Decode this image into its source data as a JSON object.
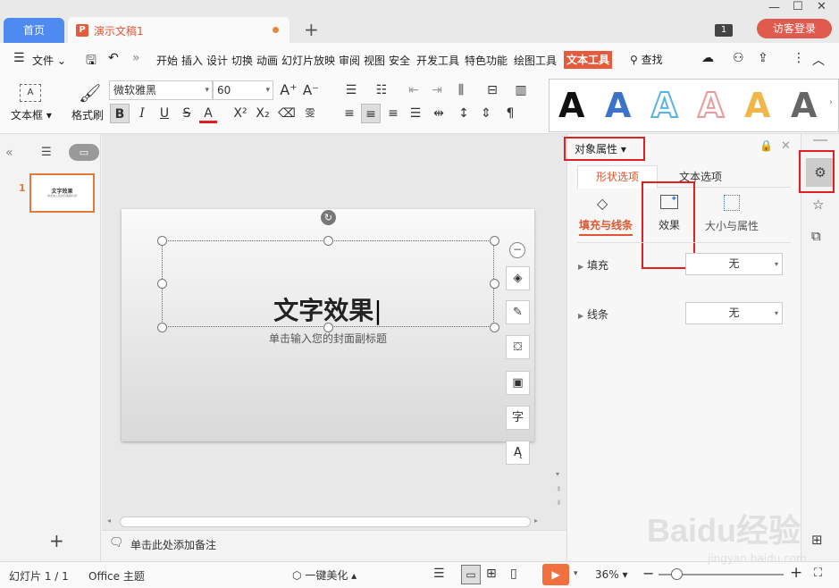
{
  "titlebar": {
    "home_tab": "首页",
    "doc_tab": "演示文稿1",
    "doc_icon": "P",
    "new_tab": "+",
    "badge": "1",
    "login_button": "访客登录"
  },
  "menu": {
    "file": "文件",
    "tabs": [
      "开始",
      "插入",
      "设计",
      "切换",
      "动画",
      "幻灯片放映",
      "审阅",
      "视图",
      "安全",
      "开发工具",
      "特色功能",
      "绘图工具"
    ],
    "active_tab": "文本工具",
    "search": "查找"
  },
  "ribbon": {
    "textbox": "文本框",
    "format_painter": "格式刷",
    "font_name": "微软雅黑",
    "font_size": "60",
    "style_letters": [
      "A",
      "A",
      "A",
      "A",
      "A",
      "A"
    ],
    "style_colors": [
      "#111111",
      "#3c73c8",
      "#58b4e0",
      "#e99a9a",
      "#f0b64a",
      "#666666"
    ]
  },
  "slide": {
    "number": "1",
    "thumb_title": "文字效果",
    "thumb_sub": "单击输入您的封面副标题",
    "title": "文字效果",
    "subtitle": "单击输入您的封面副标题"
  },
  "notes": {
    "placeholder": "单击此处添加备注"
  },
  "props": {
    "header": "对象属性",
    "tab_shape": "形状选项",
    "tab_text": "文本选项",
    "sub_fill_line": "填充与线条",
    "sub_effect": "效果",
    "sub_size": "大小与属性",
    "fill_label": "填充",
    "fill_value": "无",
    "line_label": "线条",
    "line_value": "无"
  },
  "status": {
    "slide_info": "幻灯片 1 / 1",
    "theme": "Office 主题",
    "beautify": "一键美化",
    "zoom": "36%"
  },
  "watermark": {
    "brand": "Baidu经验",
    "url": "jingyan.baidu.com"
  },
  "colors": {
    "accent_orange": "#e0552f",
    "home_blue": "#4f8af0",
    "highlight_red": "#e02020",
    "play_orange": "#f07040"
  }
}
